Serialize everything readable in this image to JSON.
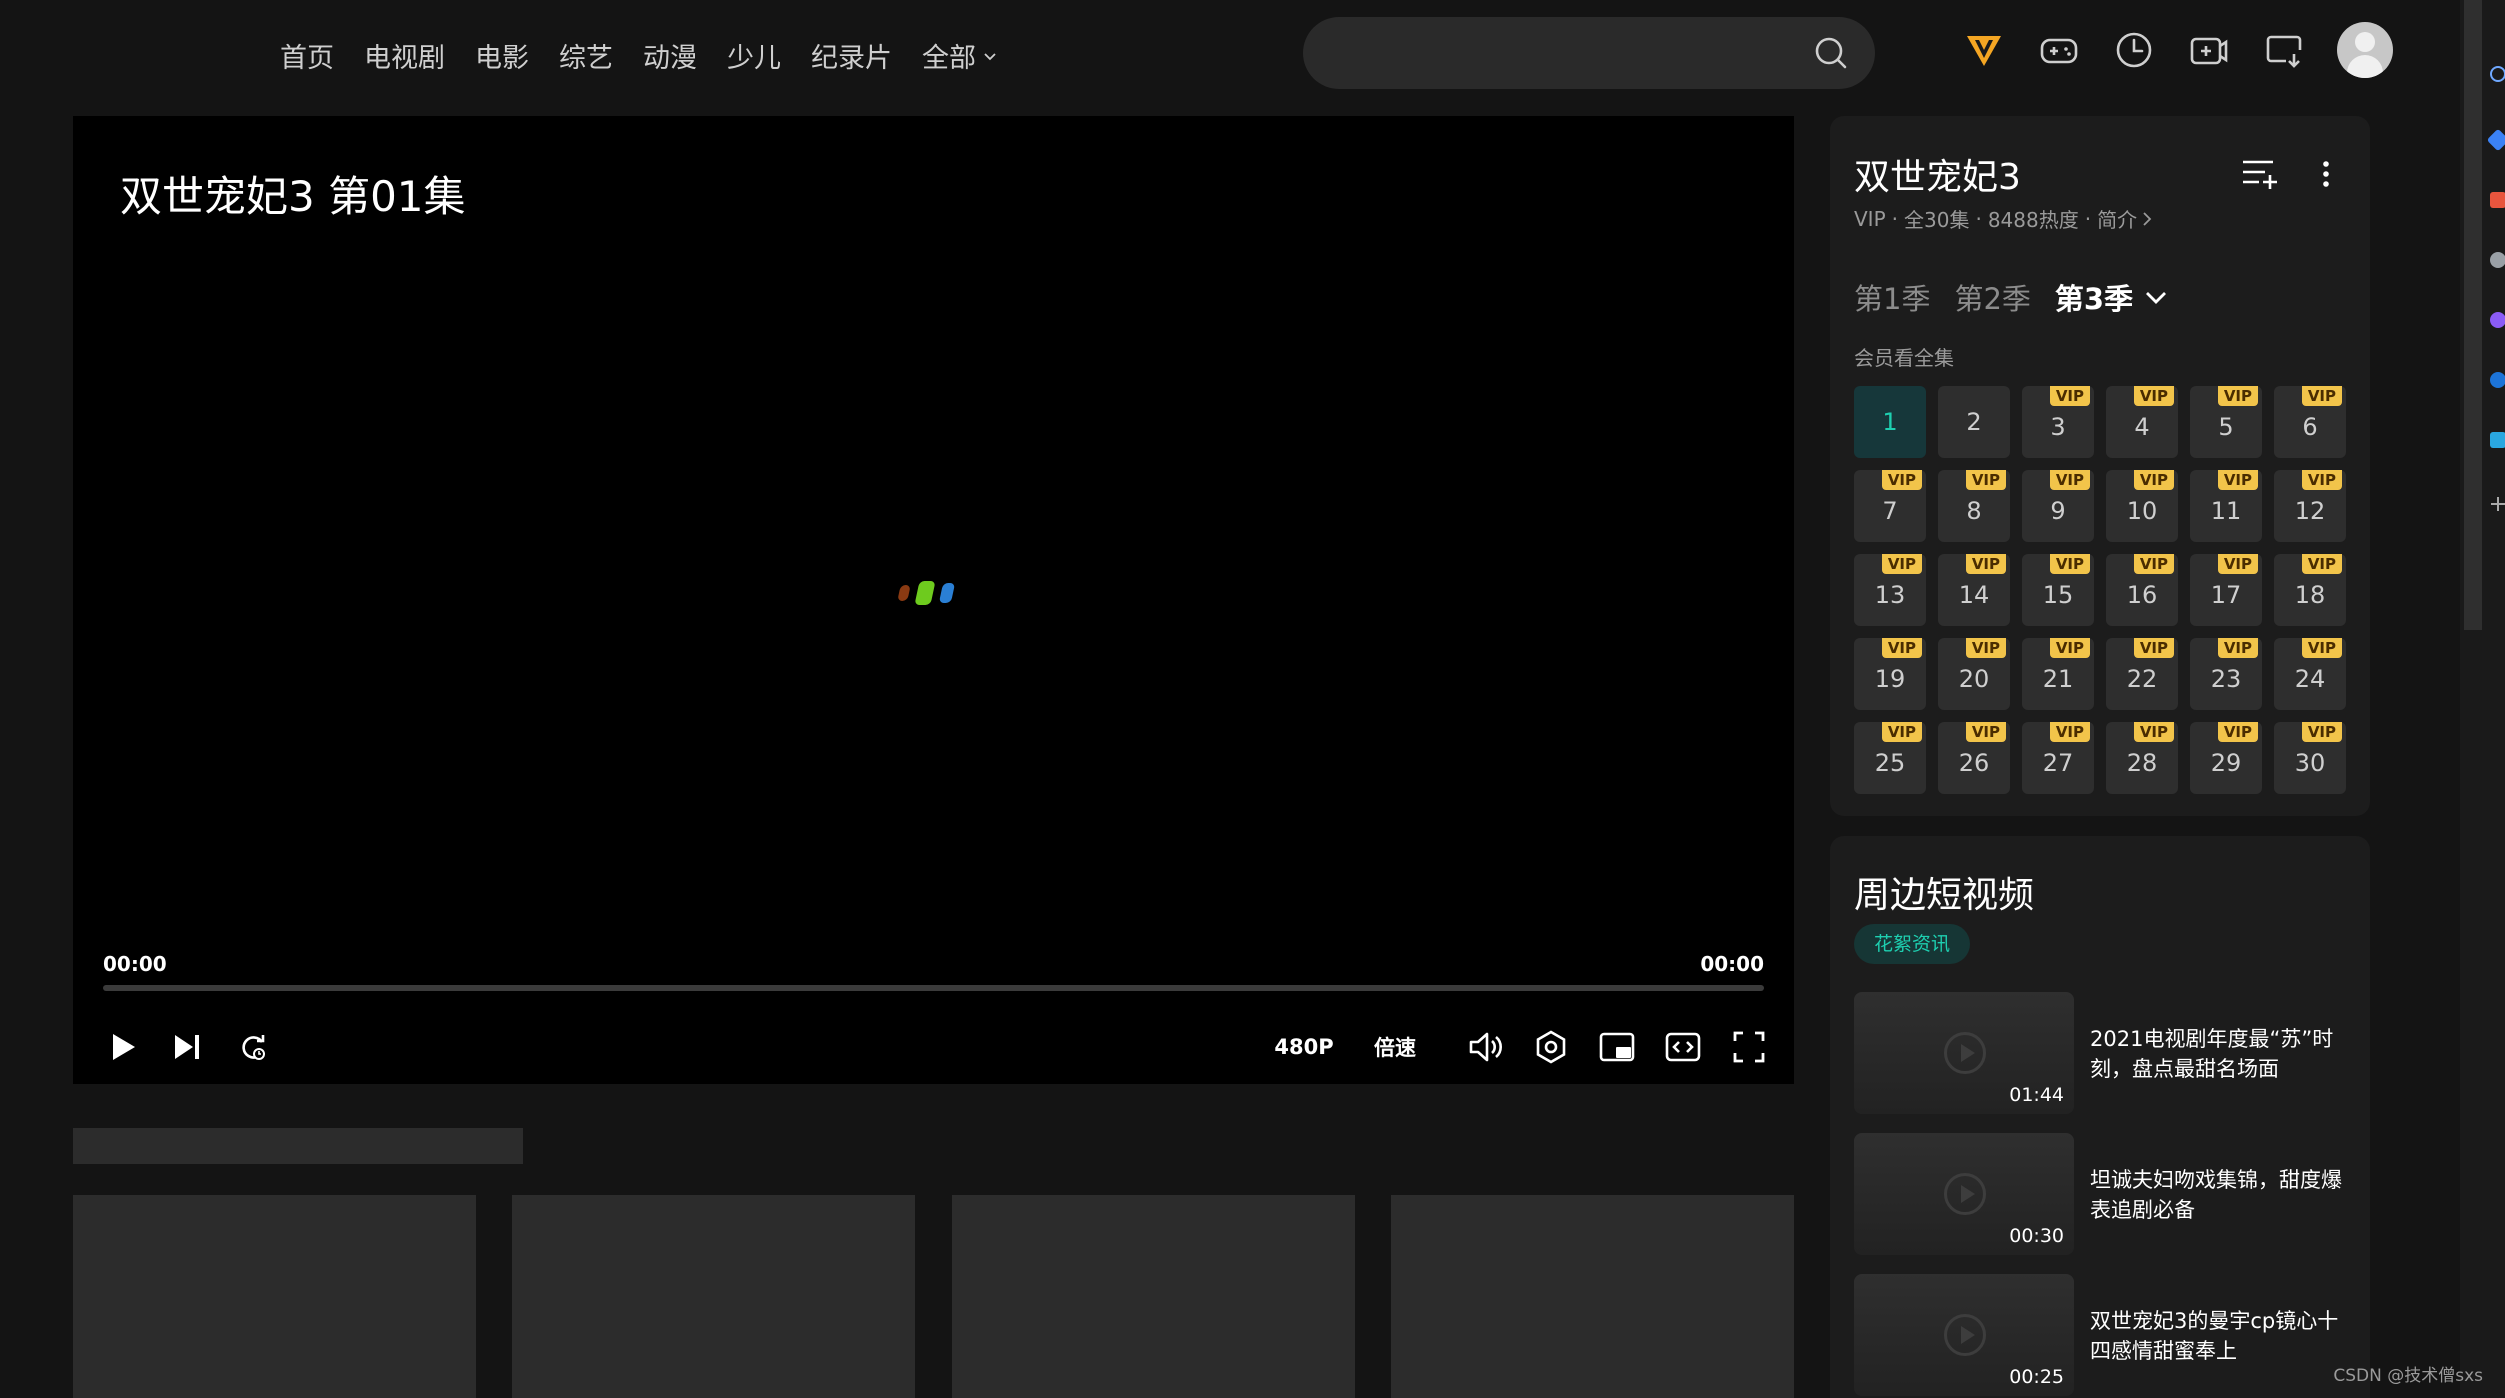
{
  "nav": {
    "items": [
      "首页",
      "电视剧",
      "电影",
      "综艺",
      "动漫",
      "少儿",
      "纪录片",
      "全部"
    ]
  },
  "search": {
    "placeholder": ""
  },
  "player": {
    "title": "双世宠妃3 第01集",
    "time_current": "00:00",
    "time_total": "00:00",
    "progress": 0,
    "quality_label": "480P",
    "speed_label": "倍速"
  },
  "show": {
    "title": "双世宠妃3",
    "meta_vip": "VIP",
    "meta_episodes": "全30集",
    "meta_heat": "8488热度",
    "meta_intro": "简介",
    "seasons": [
      "第1季",
      "第2季",
      "第3季"
    ],
    "active_season": "第3季",
    "vip_note": "会员看全集",
    "vip_badge": "VIP",
    "episodes": [
      "1",
      "2",
      "3",
      "4",
      "5",
      "6",
      "7",
      "8",
      "9",
      "10",
      "11",
      "12",
      "13",
      "14",
      "15",
      "16",
      "17",
      "18",
      "19",
      "20",
      "21",
      "22",
      "23",
      "24",
      "25",
      "26",
      "27",
      "28",
      "29",
      "30"
    ]
  },
  "shorts": {
    "title": "周边短视频",
    "tag": "花絮资讯",
    "clips": [
      {
        "title": "2021电视剧年度最“苏”时刻，盘点最甜名场面",
        "duration": "01:44"
      },
      {
        "title": "坦诚夫妇吻戏集锦，甜度爆表追剧必备",
        "duration": "00:30"
      },
      {
        "title": "双世宠妃3的曼宇cp镜心十四感情甜蜜奉上",
        "duration": "00:25"
      }
    ]
  },
  "watermark": "CSDN @技术僧sxs",
  "colors": {
    "accent": "#1ecfb0",
    "vip_badge": "#f2c44a",
    "background": "#141414",
    "panel": "#1c1c1c"
  }
}
